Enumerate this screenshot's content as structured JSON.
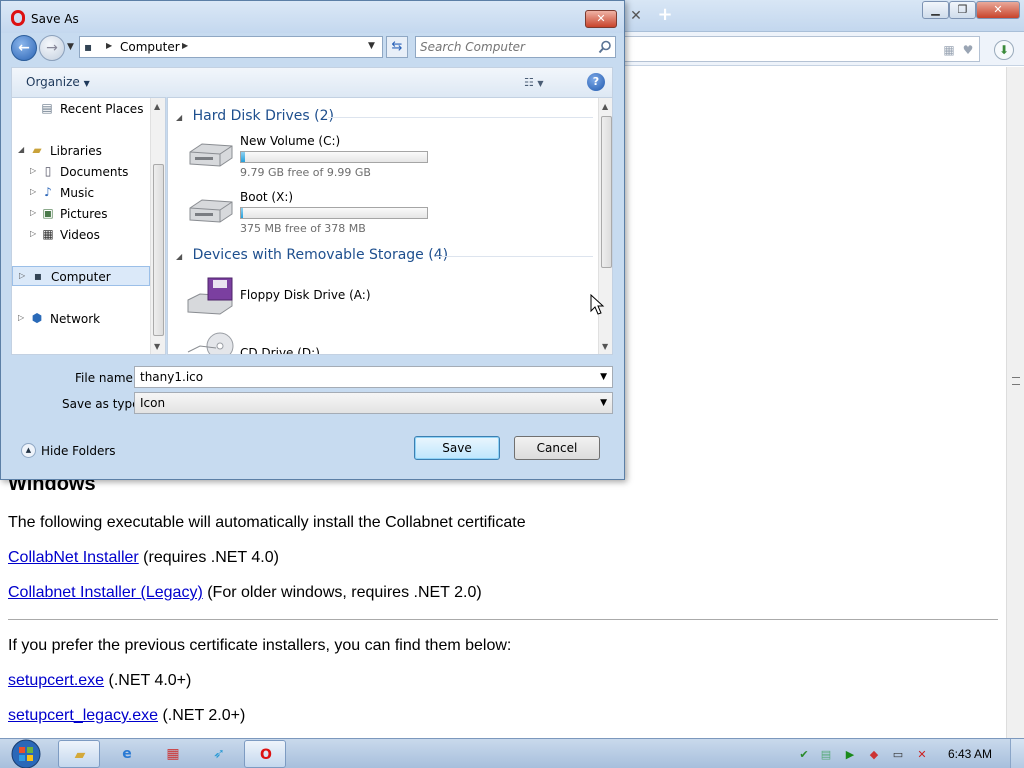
{
  "dialog": {
    "title": "Save As",
    "breadcrumb": "Computer",
    "search_placeholder": "Search Computer",
    "organize_label": "Organize",
    "nav": {
      "recent_places": "Recent Places",
      "libraries": "Libraries",
      "documents": "Documents",
      "music": "Music",
      "pictures": "Pictures",
      "videos": "Videos",
      "computer": "Computer",
      "network": "Network"
    },
    "groups": [
      {
        "header": "Hard Disk Drives (2)",
        "drives": [
          {
            "name": "New Volume (C:)",
            "free": "9.79 GB free of 9.99 GB",
            "used_fraction": 0.02
          },
          {
            "name": "Boot (X:)",
            "free": "375 MB free of 378 MB",
            "used_fraction": 0.008
          }
        ]
      },
      {
        "header": "Devices with Removable Storage (4)",
        "drives": [
          {
            "name": "Floppy Disk Drive (A:)"
          },
          {
            "name": "CD Drive (D:)"
          }
        ]
      }
    ],
    "file_name_label": "File name:",
    "file_name_value": "thany1.ico",
    "save_type_label": "Save as type:",
    "save_type_value": "Icon",
    "hide_folders": "Hide Folders",
    "save_button": "Save",
    "cancel_button": "Cancel"
  },
  "page": {
    "heading": "Windows",
    "intro": "The following executable will automatically install the Collabnet certificate",
    "link1": "CollabNet Installer",
    "link1_note": " (requires .NET 4.0)",
    "link2": "Collabnet Installer (Legacy)",
    "link2_note": " (For older windows, requires .NET 2.0)",
    "previous": "If you prefer the previous certificate installers, you can find them below:",
    "link3": "setupcert.exe",
    "link3_note": " (.NET 4.0+)",
    "link4": "setupcert_legacy.exe",
    "link4_note": " (.NET 2.0+)"
  },
  "taskbar": {
    "clock": "6:43 AM",
    "items": [
      "explorer",
      "internet-explorer",
      "app-red",
      "app-bird",
      "opera"
    ]
  },
  "colors": {
    "link": "#0000cc",
    "group_header": "#1e4f8e",
    "drive_fill": "#26a0da",
    "opera_red": "#dd1111"
  }
}
